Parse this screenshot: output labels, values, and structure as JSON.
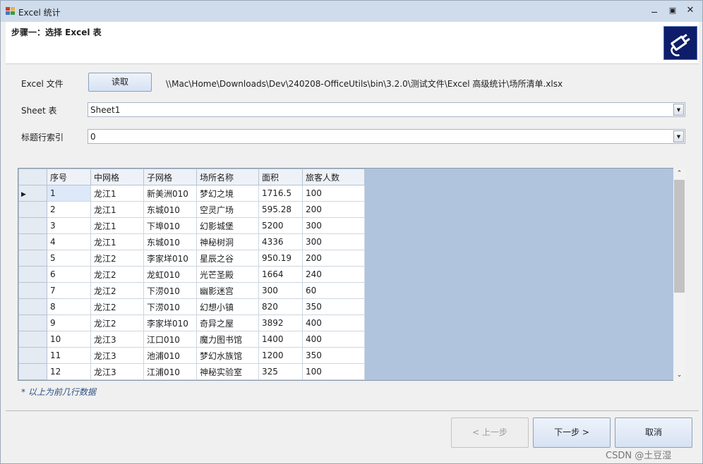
{
  "window": {
    "title": "Excel 统计"
  },
  "header": {
    "step_title": "步骤一：选择 Excel 表"
  },
  "form": {
    "excel_file_label": "Excel 文件",
    "read_button": "读取",
    "file_path": "\\\\Mac\\Home\\Downloads\\Dev\\240208-OfficeUtils\\bin\\3.2.0\\测试文件\\Excel 高级统计\\场所清单.xlsx",
    "sheet_label": "Sheet 表",
    "sheet_value": "Sheet1",
    "header_index_label": "标题行索引",
    "header_index_value": "0"
  },
  "grid": {
    "columns": [
      "序号",
      "中网格",
      "子网格",
      "场所名称",
      "面积",
      "旅客人数"
    ],
    "rows": [
      [
        "1",
        "龙江1",
        "新美洲010",
        "梦幻之境",
        "1716.5",
        "100"
      ],
      [
        "2",
        "龙江1",
        "东城010",
        "空灵广场",
        "595.28",
        "200"
      ],
      [
        "3",
        "龙江1",
        "下埠010",
        "幻影城堡",
        "5200",
        "300"
      ],
      [
        "4",
        "龙江1",
        "东城010",
        "神秘树洞",
        "4336",
        "300"
      ],
      [
        "5",
        "龙江2",
        "李家垟010",
        "星辰之谷",
        "950.19",
        "200"
      ],
      [
        "6",
        "龙江2",
        "龙虹010",
        "光芒圣殿",
        "1664",
        "240"
      ],
      [
        "7",
        "龙江2",
        "下涝010",
        "幽影迷宫",
        "300",
        "60"
      ],
      [
        "8",
        "龙江2",
        "下涝010",
        "幻想小镇",
        "820",
        "350"
      ],
      [
        "9",
        "龙江2",
        "李家垟010",
        "奇异之屋",
        "3892",
        "400"
      ],
      [
        "10",
        "龙江3",
        "江口010",
        "魔力图书馆",
        "1400",
        "400"
      ],
      [
        "11",
        "龙江3",
        "池浦010",
        "梦幻水族馆",
        "1200",
        "350"
      ],
      [
        "12",
        "龙江3",
        "江浦010",
        "神秘实验室",
        "325",
        "100"
      ]
    ]
  },
  "note": "* 以上为前几行数据",
  "footer": {
    "prev_button": "< 上一步",
    "next_button": "下一步 >",
    "cancel_button": "取消"
  },
  "watermark": "CSDN @土豆湿"
}
